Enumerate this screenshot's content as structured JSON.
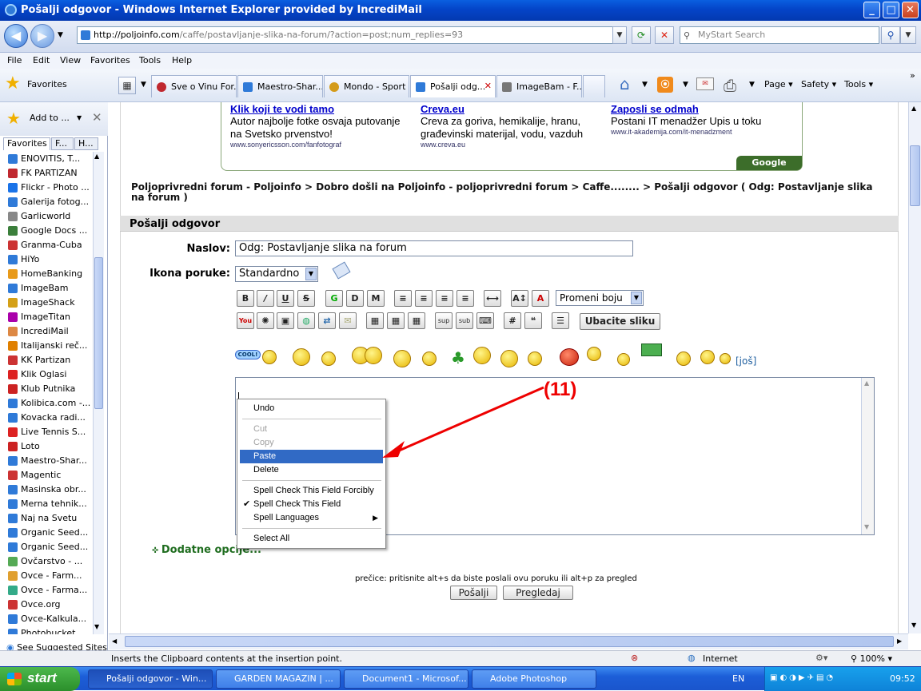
{
  "window": {
    "title": "Pošalji odgovor - Windows Internet Explorer provided by IncrediMail"
  },
  "address": {
    "url_host": "http://poljoinfo.com",
    "url_path": "/caffe/postavljanje-slika-na-forum/?action=post;num_replies=93",
    "search_placeholder": "MyStart Search"
  },
  "menu": [
    "File",
    "Edit",
    "View",
    "Favorites",
    "Tools",
    "Help"
  ],
  "favorites_button": "Favorites",
  "add_to_label": "Add to ...",
  "tabs": [
    {
      "label": "Sve o Vinu For...",
      "color": "#c0282f"
    },
    {
      "label": "Maestro-Shar...",
      "color": "#2f7ad8"
    },
    {
      "label": "Mondo - Sport",
      "color": "#d49b1a"
    },
    {
      "label": "Pošalji odg...",
      "color": "#2f7ad8"
    },
    {
      "label": "ImageBam - F...",
      "color": "#777777"
    }
  ],
  "toolbar_right": {
    "page": "Page",
    "safety": "Safety",
    "tools": "Tools"
  },
  "fav_panel": {
    "tabs": [
      "Favorites",
      "F...",
      "H..."
    ],
    "items": [
      "ENOVITIS, T...",
      "FK PARTIZAN",
      "Flickr - Photo ...",
      "Galerija fotog...",
      "Garlicworld",
      "Google Docs ...",
      "Granma-Cuba",
      "HiYo",
      "HomeBanking",
      "ImageBam",
      "ImageShack",
      "ImageTitan",
      "IncrediMail",
      "Italijanski reč...",
      "KK Partizan",
      "Klik Oglasi",
      "Klub Putnika",
      "Kolibica.com -...",
      "Kovacka radi...",
      "Live Tennis S...",
      "Loto",
      "Maestro-Shar...",
      "Magentic",
      "Masinska obr...",
      "Merna tehnik...",
      "Naj na Svetu",
      "Organic Seed...",
      "Organic Seed...",
      "Ovčarstvo - ...",
      "Ovce - Farm...",
      "Ovce - Farma...",
      "Ovce.org",
      "Ovce-Kalkula...",
      "Photobucket"
    ],
    "suggested": "See Suggested Sites"
  },
  "ads": [
    {
      "title": "Klik koji te vodi tamo",
      "desc": "Autor najbolje fotke osvaja putovanje na Svetsko prvenstvo!",
      "url": "www.sonyericsson.com/fanfotograf"
    },
    {
      "title": "Creva.eu",
      "desc": "Creva za goriva, hemikalije, hranu, građevinski materijal, vodu, vazduh",
      "url": "www.creva.eu"
    },
    {
      "title": "Zaposli se odmah",
      "desc": "Postani IT menadžer Upis u toku",
      "url": "www.it-akademija.com/it-menadzment"
    }
  ],
  "google_ads": "Google oglasi",
  "breadcrumb": "Poljoprivredni forum - Poljoinfo > Dobro došli na Poljoinfo - poljoprivredni forum > Caffe........ > Pošalji odgovor ( Odg: Postavljanje slika na forum )",
  "form": {
    "section_title": "Pošalji odgovor",
    "naslov_label": "Naslov:",
    "naslov_value": "Odg: Postavljanje slika na forum",
    "ikona_label": "Ikona poruke:",
    "ikona_value": "Standardno",
    "color_select": "Promeni boju",
    "insert_image": "Ubacite sliku",
    "more_smileys": "[još]",
    "extra_options": "Dodatne opcije...",
    "shortcut_hint": "prečice: pritisnite alt+s da biste poslali ovu poruku ili alt+p za pregled",
    "send": "Pošalji",
    "preview": "Pregledaj"
  },
  "context_menu": {
    "undo": "Undo",
    "cut": "Cut",
    "copy": "Copy",
    "paste": "Paste",
    "delete": "Delete",
    "spell_forcibly": "Spell Check This Field Forcibly",
    "spell_field": "Spell Check This Field",
    "spell_languages": "Spell Languages",
    "select_all": "Select All"
  },
  "annotation": "(11)",
  "status": {
    "text": "Inserts the Clipboard contents at the insertion point.",
    "zone": "Internet",
    "zoom": "100%"
  },
  "taskbar": {
    "start": "start",
    "tasks": [
      "Pošalji odgovor - Win...",
      "GARDEN MAGAZIN | ...",
      "Document1 - Microsof...",
      "Adobe Photoshop"
    ],
    "lang": "EN",
    "clock": "09:52"
  },
  "colors": {
    "accent": "#316ac5",
    "annotation": "#ee0000",
    "forum_green": "#1f6d1f"
  }
}
